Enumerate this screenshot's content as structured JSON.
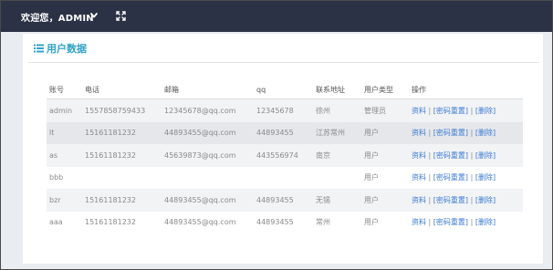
{
  "topbar": {
    "welcome_text": "欢迎您，ADMIN",
    "user_menu_icon": "chevron-down-icon",
    "fullscreen_icon": "expand-icon",
    "background_color": "#2b3245"
  },
  "section": {
    "icon": "list-icon",
    "title": "用户数据",
    "title_color": "#2fa3c9"
  },
  "table": {
    "columns": [
      "账号",
      "电话",
      "邮箱",
      "qq",
      "联系地址",
      "用户类型",
      "操作"
    ],
    "action_labels": {
      "info": "资料",
      "reset_password": "[密码重置]",
      "delete": "[删除]",
      "separator": "|"
    },
    "link_color": "#3a7bd5",
    "rows": [
      {
        "account": "admin",
        "phone": "1557858759433",
        "email": "12345678@qq.com",
        "qq": "12345678",
        "address": "徐州",
        "type": "管理员"
      },
      {
        "account": "lt",
        "phone": "15161181232",
        "email": "44893455@qq.com",
        "qq": "44893455",
        "address": "江苏常州",
        "type": "用户"
      },
      {
        "account": "as",
        "phone": "15161181232",
        "email": "45639873@qq.com",
        "qq": "443556974",
        "address": "南京",
        "type": "用户"
      },
      {
        "account": "bbb",
        "phone": "",
        "email": "",
        "qq": "",
        "address": "",
        "type": "用户"
      },
      {
        "account": "bzr",
        "phone": "15161181232",
        "email": "44893455@qq.com",
        "qq": "44893455",
        "address": "无锡",
        "type": "用户"
      },
      {
        "account": "aaa",
        "phone": "15161181232",
        "email": "44893455@qq.com",
        "qq": "44893455",
        "address": "常州",
        "type": "用户"
      }
    ]
  }
}
